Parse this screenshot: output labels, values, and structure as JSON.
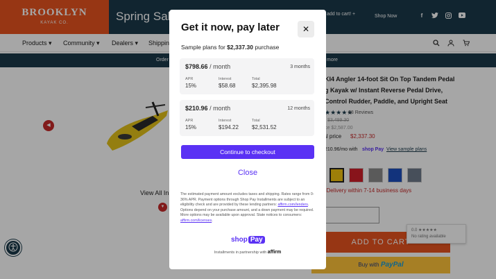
{
  "header": {
    "logo_main": "BROOKLYN",
    "logo_sub": "KAYAK CO.",
    "promo_title": "Spring Sale",
    "promo_text": "add to cart! +",
    "shop_now": "Shop Now",
    "social_icons": [
      "facebook-icon",
      "twitter-icon",
      "instagram-icon",
      "youtube-icon"
    ]
  },
  "nav": {
    "items": [
      "Products",
      "Community",
      "Dealers",
      "Shipping"
    ],
    "icons": [
      "search-icon",
      "account-icon",
      "cart-icon"
    ]
  },
  "announcement": {
    "left_text": "Order",
    "right_text": "more"
  },
  "product": {
    "title_lines": [
      "KI4 Angler 14-foot Sit On Top Tandem Pedal",
      "g Kayak w/ Instant Reverse Pedal Drive,",
      "Control Rudder, Paddle, and Upright Seat"
    ],
    "stars": "★★★★★",
    "reviews": "88 Reviews",
    "strike_price_1": "$3,499.30",
    "strike_price_2": "ce  $2,587.00",
    "final_price_label": "nal price",
    "final_price": "$2,337.30",
    "installment_text": "210.96/mo with",
    "shoppay_mini": "shop Pay",
    "sample_plans_link": "View sample plans",
    "color_label": "w",
    "delivery": "k: Delivery within 7-14 business days",
    "view_all": "View All In",
    "add_to_cart": "ADD TO CART",
    "paypal_prefix": "Buy with",
    "paypal_brand": "PayPal",
    "rating_widget_1": "0.0 ★★★★★",
    "rating_widget_2": "No rating available",
    "swatch_colors": [
      "#f2c40f",
      "#d11f2a",
      "#8a8a8a",
      "#1d4fbf",
      "#6d7a8a"
    ]
  },
  "modal": {
    "title": "Get it now, pay later",
    "sample_prefix": "Sample plans for",
    "sample_amount": "$2,337.30",
    "sample_suffix": "purchase",
    "plans": [
      {
        "price": "$798.66",
        "per": "/ month",
        "months": "3 months",
        "apr_label": "APR",
        "apr": "15%",
        "interest_label": "Interest",
        "interest": "$58.68",
        "total_label": "Total",
        "total": "$2,395.98"
      },
      {
        "price": "$210.96",
        "per": "/ month",
        "months": "12 months",
        "apr_label": "APR",
        "apr": "15%",
        "interest_label": "Interest",
        "interest": "$194.22",
        "total_label": "Total",
        "total": "$2,531.52"
      }
    ],
    "checkout_label": "Continue to checkout",
    "close_label": "Close",
    "disclaimer_1": "The estimated payment amount excludes taxes and shipping. Rates range from 0-36% APR. Payment options through Shop Pay Installments are subject to an eligibility check and are provided by these lending partners: ",
    "disclaimer_link_1": "affirm.com/lenders",
    "disclaimer_2": ". Options depend on your purchase amount, and a down payment may be required. More options may be available upon approval. State notices to consumers: ",
    "disclaimer_link_2": "affirm.com/licenses",
    "disclaimer_3": ".",
    "shoppay_text": "shop",
    "shoppay_badge": "Pay",
    "affirm_prefix": "Installments in partnership with",
    "affirm_brand": "affirm"
  },
  "colors": {
    "brand_orange": "#e8541f",
    "navy": "#1b3a4b",
    "shop_pay_purple": "#5a31f4",
    "paypal_yellow": "#ffc439",
    "sale_red": "#c62828"
  }
}
